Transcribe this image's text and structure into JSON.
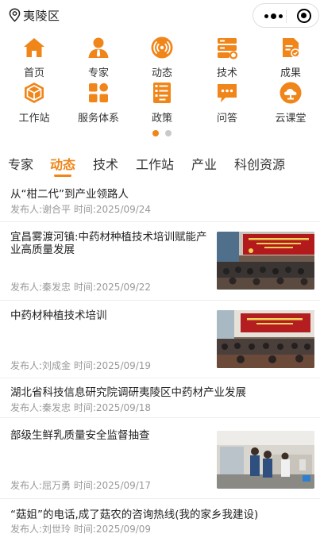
{
  "location": {
    "text": "夷陵区",
    "icon": "location-pin-icon"
  },
  "capsule": {
    "more_icon": "more-dots-icon",
    "close_icon": "target-close-icon"
  },
  "grid": [
    {
      "label": "首页",
      "icon": "home-icon"
    },
    {
      "label": "专家",
      "icon": "expert-icon"
    },
    {
      "label": "动态",
      "icon": "broadcast-icon"
    },
    {
      "label": "技术",
      "icon": "technology-icon"
    },
    {
      "label": "成果",
      "icon": "achievement-icon"
    },
    {
      "label": "工作站",
      "icon": "workstation-icon"
    },
    {
      "label": "服务体系",
      "icon": "service-grid-icon"
    },
    {
      "label": "政策",
      "icon": "policy-icon"
    },
    {
      "label": "问答",
      "icon": "qa-chat-icon"
    },
    {
      "label": "云课堂",
      "icon": "cloud-class-icon"
    }
  ],
  "accent": "#f08519",
  "tabs": [
    {
      "label": "专家"
    },
    {
      "label": "动态",
      "active": true
    },
    {
      "label": "技术"
    },
    {
      "label": "工作站"
    },
    {
      "label": "产业"
    },
    {
      "label": "科创资源"
    }
  ],
  "news": [
    {
      "title": "从“柑二代”到产业领路人",
      "meta": "发布人:谢合平 时间:2025/09/24",
      "has_image": false
    },
    {
      "title": "宜昌雾渡河镇:中药材种植技术培训赋能产业高质量发展",
      "meta": "发布人:秦发忠 时间:2025/09/22",
      "has_image": true
    },
    {
      "title": "中药材种植技术培训",
      "meta": "发布人:刘成金 时间:2025/09/19",
      "has_image": true
    },
    {
      "title": "湖北省科技信息研究院调研夷陵区中药材产业发展",
      "meta": "发布人:秦发忠 时间:2025/09/18",
      "has_image": false
    },
    {
      "title": "部级生鲜乳质量安全监督抽查",
      "meta": "发布人:屈万勇 时间:2025/09/17",
      "has_image": true
    },
    {
      "title": "“菇姐”的电话,成了菇农的咨询热线(我的家乡我建设)",
      "meta": "发布人:刘世玲 时间:2025/09/09",
      "has_image": false
    }
  ]
}
